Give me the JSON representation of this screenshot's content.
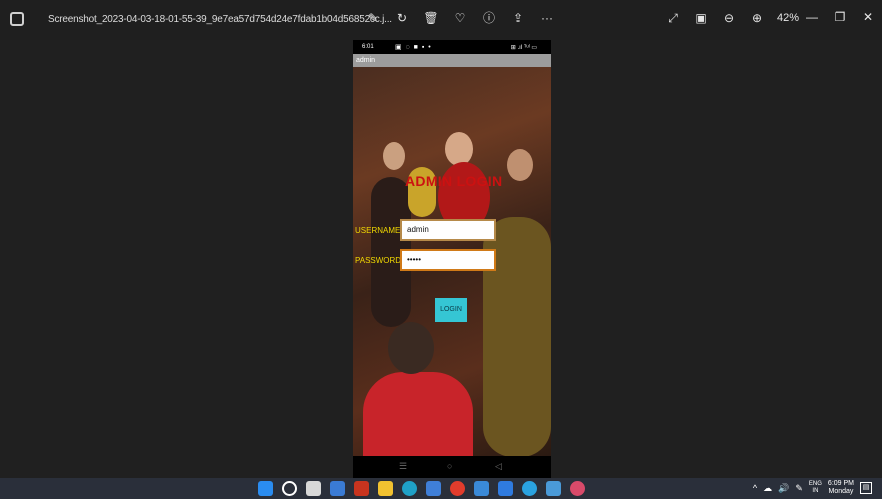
{
  "titlebar": {
    "filename": "Screenshot_2023-04-03-18-01-55-39_9e7ea57d754d24e7fdab1b04d56852cc.j...",
    "zoom": "42%",
    "tools": [
      "edit-icon",
      "rotate-icon",
      "delete-icon",
      "favorite-icon",
      "info-icon",
      "share-icon",
      "more-icon"
    ],
    "more_label": "···"
  },
  "phone": {
    "status_time": "6:01",
    "status_signal": "⊞ .ıl ᵀᵘˡ ▭",
    "appbar_title": "admin",
    "heading": "ADMIN LOGIN",
    "username_label": "USERNAME",
    "username_value": "admin",
    "password_label": "PASSWORD",
    "password_value": "•••••",
    "login_button": "LOGIN"
  },
  "taskbar": {
    "lang_line1": "ENG",
    "lang_line2": "IN",
    "time": "6:09 PM",
    "day": "Monday"
  },
  "colors": {
    "heading": "#cc1111",
    "labels": "#f2d900",
    "button": "#35c6d4"
  }
}
